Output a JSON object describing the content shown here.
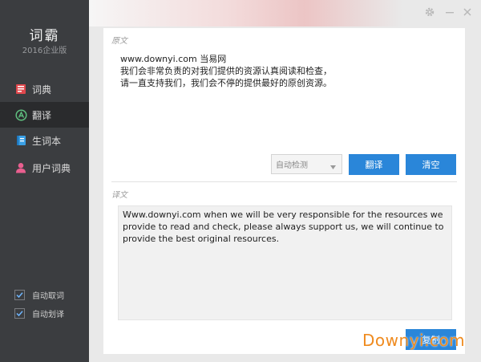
{
  "app": {
    "title": "词霸",
    "edition": "2016企业版"
  },
  "sidebar": {
    "items": [
      {
        "label": "词典",
        "icon": "book-icon",
        "color": "#e0484d",
        "active": false
      },
      {
        "label": "翻译",
        "icon": "translate-icon",
        "color": "#5fbf7f",
        "active": true
      },
      {
        "label": "生词本",
        "icon": "notebook-icon",
        "color": "#3aa0e6",
        "active": false
      },
      {
        "label": "用户词典",
        "icon": "user-icon",
        "color": "#e95f8f",
        "active": false
      }
    ],
    "options": [
      {
        "label": "自动取词",
        "checked": true
      },
      {
        "label": "自动划译",
        "checked": true
      }
    ]
  },
  "window_controls": {
    "icons": [
      "gear-icon",
      "minimize-icon",
      "close-icon"
    ]
  },
  "source": {
    "label": "原文",
    "lines": [
      "www.downyi.com  当易网",
      "我们会非常负责的对我们提供的资源认真阅读和检查，",
      "请一直支持我们，我们会不停的提供最好的原创资源。"
    ]
  },
  "controls": {
    "language_selected": "自动检测",
    "translate_label": "翻译",
    "clear_label": "清空"
  },
  "result": {
    "label": "译文",
    "text": "Www.downyi.com when we will be very responsible for the resources we provide to read and check, please always support us, we will continue to provide the best original resources.",
    "copy_label": "复制"
  },
  "watermark": "Downyi.com",
  "colors": {
    "sidebar_bg": "#3b3d40",
    "accent": "#2a86d9",
    "watermark": "#ef8b1f"
  }
}
